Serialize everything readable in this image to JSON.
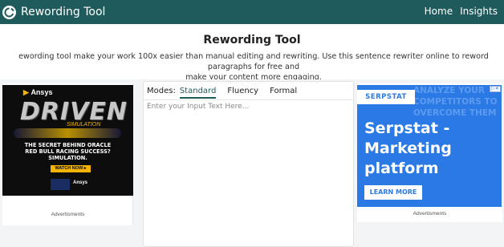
{
  "header": {
    "brand": "Rewording Tool",
    "nav": [
      "Home",
      "Insights"
    ]
  },
  "hero": {
    "title": "Rewording Tool",
    "intro_line1": "ewording tool make your work 100x easier than manual editing and rewriting. Use this sentence rewriter online to reword paragraphs for free and",
    "intro_line2": "make your content more engaging."
  },
  "editor": {
    "modes_label": "Modes:",
    "modes": [
      "Standard",
      "Fluency",
      "Formal"
    ],
    "active_mode": "Standard",
    "placeholder": "Enter your Input Text Here..."
  },
  "ad_left": {
    "brand": "Ansys",
    "headline": "DRIVEN",
    "sub": "SIMULATION",
    "copy_line1": "THE SECRET BEHIND ORACLE",
    "copy_line2": "RED BULL RACING SUCCESS?",
    "copy_line3": "SIMULATION.",
    "cta": "WATCH NOW ▸",
    "brand_small": "Ansys",
    "label": "Advertisments"
  },
  "ad_right": {
    "logo": "SERPSTAT",
    "ghost_text": "ANALYZE YOUR COMPETITORS TO OVERCOME THEM",
    "headline_line1": "Serpstat -",
    "headline_line2": "Marketing",
    "headline_line3": "platform",
    "cta": "LEARN MORE",
    "adchoices": "▷✕",
    "label": "Advertisments"
  },
  "colors": {
    "header_bg": "#1f5b5c",
    "accent": "#1f5b5c",
    "serpstat_blue": "#2a79e4",
    "ansys_yellow": "#f5b400"
  }
}
